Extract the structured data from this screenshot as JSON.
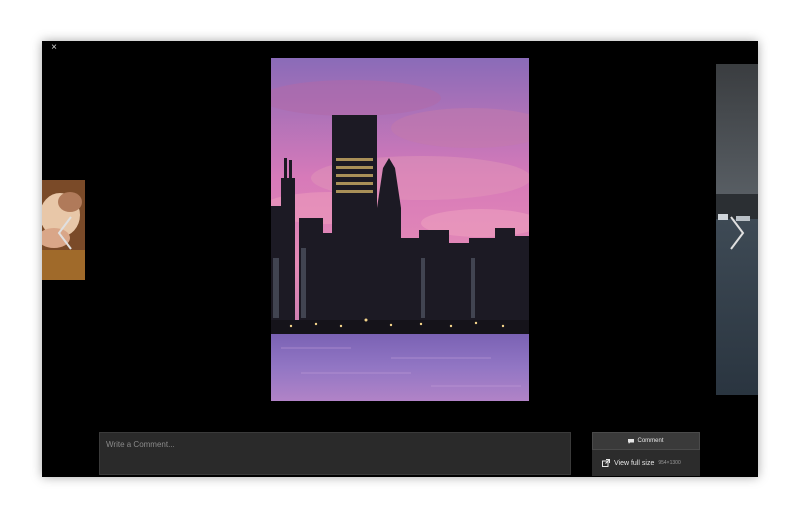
{
  "lightbox": {
    "close_label": "×",
    "comment_placeholder": "Write a Comment...",
    "comment_button_label": "Comment",
    "view_full_size_label": "View full size",
    "image_dimensions": "954×1300"
  },
  "icons": {
    "close": "close-icon",
    "prev": "chevron-left-icon",
    "next": "chevron-right-icon",
    "comment": "speech-bubble-icon",
    "view_full": "external-link-icon"
  },
  "colors": {
    "backdrop": "#ffffff",
    "lightbox_bg": "#000000",
    "input_bg": "#2a2a2a",
    "button_bg": "#3a3a3a"
  }
}
